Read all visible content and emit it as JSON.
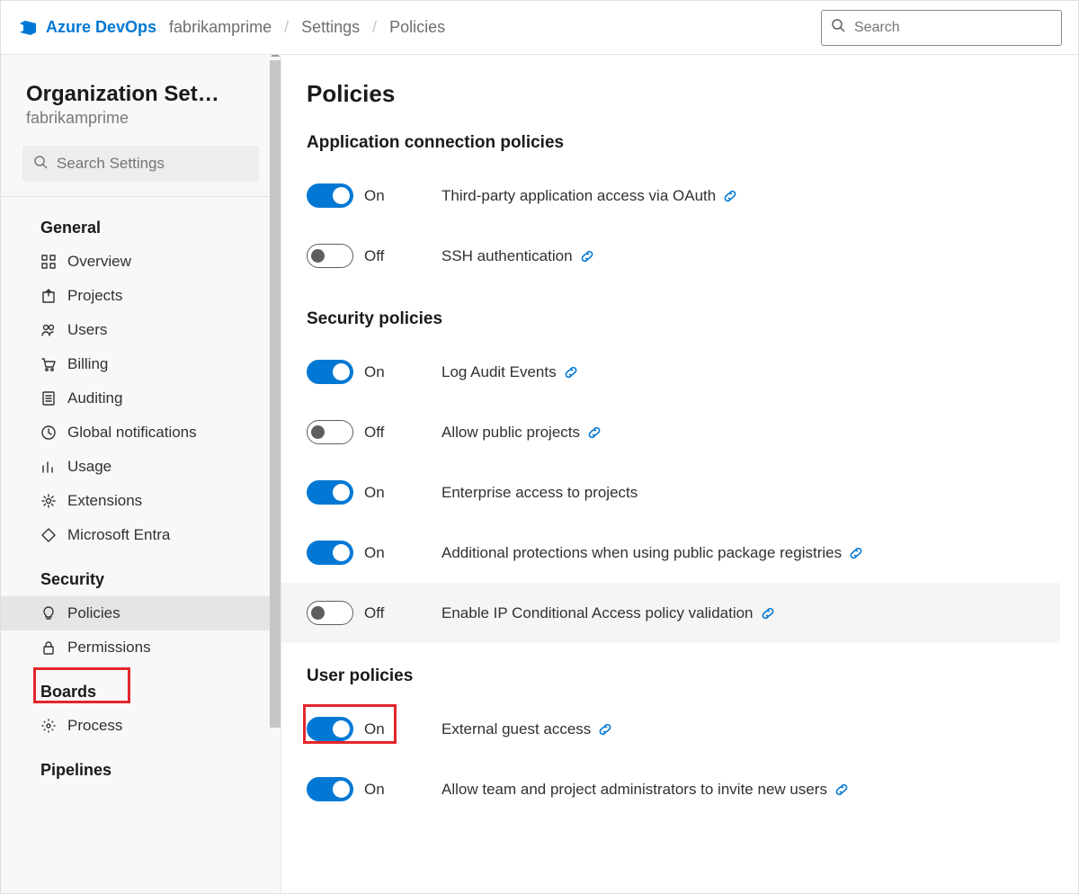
{
  "header": {
    "brand": "Azure DevOps",
    "breadcrumbs": [
      "fabrikamprime",
      "Settings",
      "Policies"
    ],
    "search_placeholder": "Search"
  },
  "sidebar": {
    "title": "Organization Settin...",
    "subtitle": "fabrikamprime",
    "search_placeholder": "Search Settings",
    "groups": [
      {
        "label": "General",
        "items": [
          {
            "key": "overview",
            "label": "Overview",
            "icon": "grid-icon"
          },
          {
            "key": "projects",
            "label": "Projects",
            "icon": "export-icon"
          },
          {
            "key": "users",
            "label": "Users",
            "icon": "users-icon"
          },
          {
            "key": "billing",
            "label": "Billing",
            "icon": "cart-icon"
          },
          {
            "key": "auditing",
            "label": "Auditing",
            "icon": "list-icon"
          },
          {
            "key": "global-notifications",
            "label": "Global notifications",
            "icon": "clock-icon"
          },
          {
            "key": "usage",
            "label": "Usage",
            "icon": "chart-icon"
          },
          {
            "key": "extensions",
            "label": "Extensions",
            "icon": "gear-icon"
          },
          {
            "key": "microsoft-entra",
            "label": "Microsoft Entra",
            "icon": "diamond-icon"
          }
        ]
      },
      {
        "label": "Security",
        "items": [
          {
            "key": "policies",
            "label": "Policies",
            "icon": "bulb-icon",
            "selected": true
          },
          {
            "key": "permissions",
            "label": "Permissions",
            "icon": "lock-icon"
          }
        ]
      },
      {
        "label": "Boards",
        "items": [
          {
            "key": "process",
            "label": "Process",
            "icon": "cog-icon"
          }
        ]
      },
      {
        "label": "Pipelines",
        "items": []
      }
    ]
  },
  "main": {
    "title": "Policies",
    "sections": [
      {
        "title": "Application connection policies",
        "key": "app",
        "rows": [
          {
            "on": true,
            "state": "On",
            "label": "Third-party application access via OAuth",
            "link": true
          },
          {
            "on": false,
            "state": "Off",
            "label": "SSH authentication",
            "link": true
          }
        ]
      },
      {
        "title": "Security policies",
        "key": "sec",
        "rows": [
          {
            "on": true,
            "state": "On",
            "label": "Log Audit Events",
            "link": true
          },
          {
            "on": false,
            "state": "Off",
            "label": "Allow public projects",
            "link": true
          },
          {
            "on": true,
            "state": "On",
            "label": "Enterprise access to projects",
            "link": false
          },
          {
            "on": true,
            "state": "On",
            "label": "Additional protections when using public package registries",
            "link": true
          },
          {
            "on": false,
            "state": "Off",
            "label": "Enable IP Conditional Access policy validation",
            "link": true,
            "hover": true
          }
        ]
      },
      {
        "title": "User policies",
        "key": "user",
        "rows": [
          {
            "on": true,
            "state": "On",
            "label": "External guest access",
            "link": true,
            "highlight": true
          },
          {
            "on": true,
            "state": "On",
            "label": "Allow team and project administrators to invite new users",
            "link": true
          }
        ]
      }
    ]
  }
}
